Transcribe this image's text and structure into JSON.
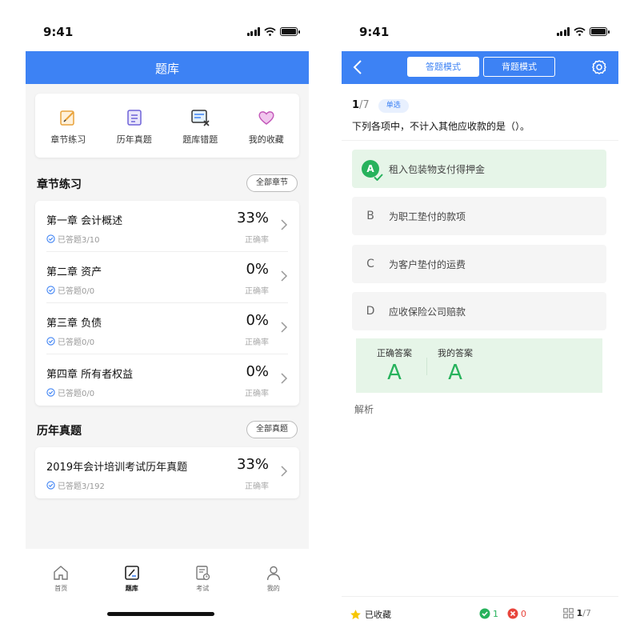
{
  "status": {
    "time": "9:41"
  },
  "library": {
    "title": "题库",
    "quick": [
      {
        "label": "章节练习",
        "icon": "edit-note-icon"
      },
      {
        "label": "历年真题",
        "icon": "document-icon"
      },
      {
        "label": "题库错题",
        "icon": "wrong-list-icon"
      },
      {
        "label": "我的收藏",
        "icon": "heart-icon"
      }
    ],
    "chapters": {
      "heading": "章节练习",
      "all_label": "全部章节",
      "items": [
        {
          "name": "第一章 会计概述",
          "answered": "已答题3/10",
          "percent": "33%",
          "percent_label": "正确率"
        },
        {
          "name": "第二章 资产",
          "answered": "已答题0/0",
          "percent": "0%",
          "percent_label": "正确率"
        },
        {
          "name": "第三章 负债",
          "answered": "已答题0/0",
          "percent": "0%",
          "percent_label": "正确率"
        },
        {
          "name": "第四章 所有者权益",
          "answered": "已答题0/0",
          "percent": "0%",
          "percent_label": "正确率"
        }
      ]
    },
    "past": {
      "heading": "历年真题",
      "all_label": "全部真题",
      "items": [
        {
          "name": "2019年会计培训考试历年真题",
          "answered": "已答题3/192",
          "percent": "33%",
          "percent_label": "正确率"
        }
      ]
    },
    "tabs": [
      {
        "label": "首页",
        "icon": "home-icon"
      },
      {
        "label": "题库",
        "icon": "question-bank-icon"
      },
      {
        "label": "考试",
        "icon": "exam-icon"
      },
      {
        "label": "我的",
        "icon": "user-icon"
      }
    ]
  },
  "quiz": {
    "modes": [
      "答题模式",
      "背题模式"
    ],
    "index": "1",
    "total": "/7",
    "type": "单选",
    "question": "下列各项中，不计入其他应收款的是（）。",
    "options": [
      {
        "letter": "A",
        "text": "租入包装物支付得押金"
      },
      {
        "letter": "B",
        "text": "为职工垫付的款项"
      },
      {
        "letter": "C",
        "text": "为客户垫付的运费"
      },
      {
        "letter": "D",
        "text": "应收保险公司赔款"
      }
    ],
    "answer": {
      "correct_label": "正确答案",
      "correct_value": "A",
      "mine_label": "我的答案",
      "mine_value": "A"
    },
    "analysis_label": "解析",
    "bottom": {
      "favorite_label": "已收藏",
      "correct_count": "1",
      "wrong_count": "0",
      "progress_current": "1",
      "progress_total": "/7"
    },
    "colors": {
      "accent": "#3d82f4",
      "correct": "#27b25c",
      "wrong": "#e8453c",
      "star": "#f7c600"
    }
  }
}
